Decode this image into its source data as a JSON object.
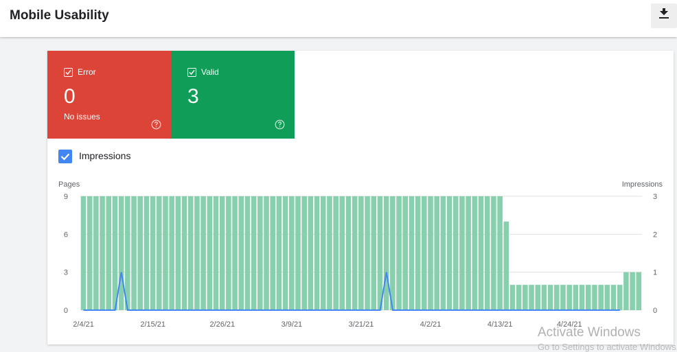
{
  "header": {
    "title": "Mobile Usability",
    "download_icon": "download-icon"
  },
  "tiles": [
    {
      "label": "Error",
      "value": "0",
      "sub": "No issues",
      "color": "#db4437"
    },
    {
      "label": "Valid",
      "value": "3",
      "sub": "",
      "color": "#0f9d58"
    }
  ],
  "impressions_toggle": {
    "label": "Impressions",
    "checked": true,
    "color": "#4285f4"
  },
  "watermark": {
    "line1": "Activate Windows",
    "line2": "Go to Settings to activate Windows."
  },
  "chart_data": {
    "type": "bar",
    "y_left_label": "Pages",
    "y_right_label": "Impressions",
    "y_left_ticks": [
      "0",
      "3",
      "6",
      "9"
    ],
    "y_right_ticks": [
      "0",
      "1",
      "2",
      "3"
    ],
    "ylim_left": [
      0,
      9
    ],
    "ylim_right": [
      0,
      3
    ],
    "x_tick_labels": [
      "2/4/21",
      "2/15/21",
      "2/26/21",
      "3/9/21",
      "3/21/21",
      "4/2/21",
      "4/13/21",
      "4/24/21"
    ],
    "grid": true,
    "bar_color": "#88d0ad",
    "line_color": "#4285f4",
    "series": [
      {
        "name": "Pages",
        "kind": "bar",
        "axis": "left",
        "values": [
          9,
          9,
          9,
          9,
          9,
          9,
          9,
          9,
          9,
          9,
          9,
          9,
          9,
          9,
          9,
          9,
          9,
          9,
          9,
          9,
          9,
          9,
          9,
          9,
          9,
          9,
          9,
          9,
          9,
          9,
          9,
          9,
          9,
          9,
          9,
          9,
          9,
          9,
          9,
          9,
          9,
          9,
          9,
          9,
          9,
          9,
          9,
          9,
          9,
          9,
          9,
          9,
          9,
          9,
          9,
          9,
          9,
          9,
          9,
          9,
          9,
          9,
          9,
          9,
          9,
          9,
          9,
          7,
          2,
          2,
          2,
          2,
          2,
          2,
          2,
          2,
          2,
          2,
          2,
          2,
          2,
          2,
          2,
          2,
          2,
          2,
          3,
          3,
          3
        ]
      },
      {
        "name": "Impressions",
        "kind": "line",
        "axis": "right",
        "values": [
          0,
          0,
          0,
          0,
          0,
          0,
          1,
          0,
          0,
          0,
          0,
          0,
          0,
          0,
          0,
          0,
          0,
          0,
          0,
          0,
          0,
          0,
          0,
          0,
          0,
          0,
          0,
          0,
          0,
          0,
          0,
          0,
          0,
          0,
          0,
          0,
          0,
          0,
          0,
          0,
          0,
          0,
          0,
          0,
          0,
          0,
          0,
          0,
          1,
          0,
          0,
          0,
          0,
          0,
          0,
          0,
          0,
          0,
          0,
          0,
          0,
          0,
          0,
          0,
          0,
          0,
          0,
          0,
          0,
          0,
          0,
          0,
          0,
          0,
          0,
          0,
          0,
          0,
          0,
          0,
          0,
          0,
          0,
          0,
          0,
          0
        ]
      }
    ]
  }
}
